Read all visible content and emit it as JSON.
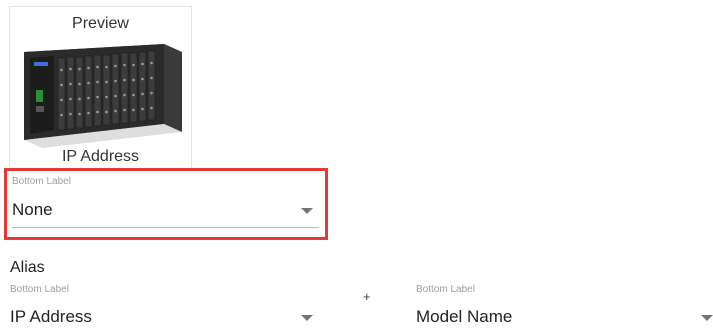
{
  "preview": {
    "title": "Preview",
    "caption": "IP Address",
    "device_icon": "rack-switch-image"
  },
  "bottom_label_select": {
    "label": "Bottom Label",
    "value": "None"
  },
  "alias": {
    "title": "Alias",
    "plus": "+",
    "left_select": {
      "label": "Bottom Label",
      "value": "IP Address"
    },
    "right_select": {
      "label": "Bottom Label",
      "value": "Model Name"
    }
  },
  "colors": {
    "highlight": "#e53935",
    "caret": "#757575",
    "label": "#9e9e9e"
  }
}
